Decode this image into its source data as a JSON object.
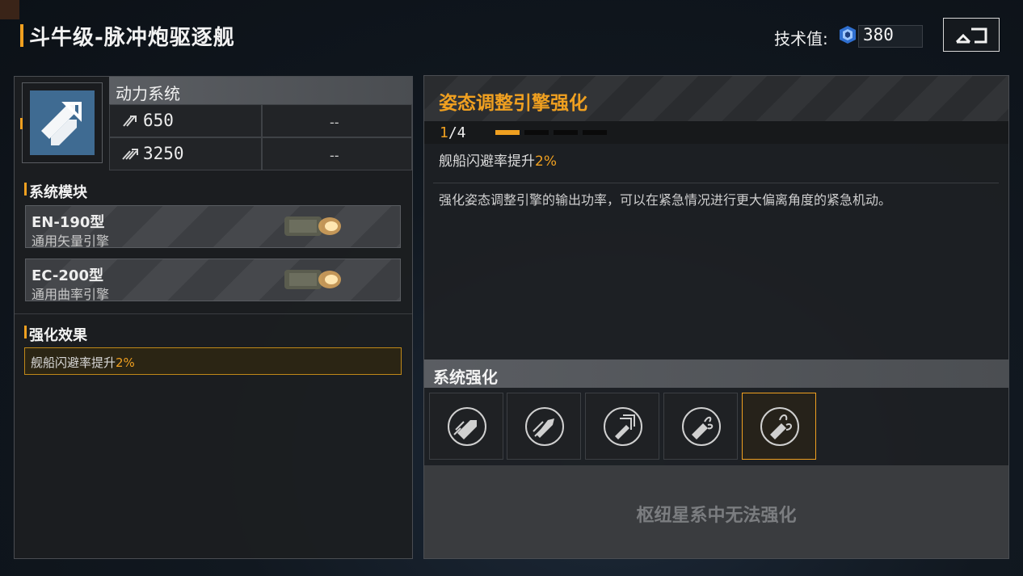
{
  "header": {
    "title": "斗牛级-脉冲炮驱逐舰",
    "tech_label": "技术值:",
    "tech_value": "380",
    "back_icon": "return-icon"
  },
  "system": {
    "icon": "engine-system-icon",
    "name": "动力系统",
    "stats": [
      {
        "icon": "speed-icon",
        "value": "650",
        "extra": "--"
      },
      {
        "icon": "boost-speed-icon",
        "value": "3250",
        "extra": "--"
      }
    ]
  },
  "modules": {
    "title": "系统模块",
    "items": [
      {
        "name": "EN-190型",
        "sub": "通用矢量引擎"
      },
      {
        "name": "EC-200型",
        "sub": "通用曲率引擎"
      }
    ]
  },
  "effects": {
    "title": "强化效果",
    "text_prefix": "舰船闪避率提升",
    "text_value": "2%"
  },
  "upgrade": {
    "title": "姿态调整引擎强化",
    "level_current": "1",
    "level_total": "/4",
    "level_progress": 0.25,
    "effect_prefix": "舰船闪避率提升",
    "effect_value": "2%",
    "description": "强化姿态调整引擎的输出功率，可以在紧急情况进行更大偏离角度的紧急机动。"
  },
  "enhance": {
    "title": "系统强化",
    "slots": [
      {
        "icon": "engine-speed-icon",
        "selected": false
      },
      {
        "icon": "engine-speed-alt-icon",
        "selected": false
      },
      {
        "icon": "engine-boost-icon",
        "selected": false
      },
      {
        "icon": "evasion-icon",
        "selected": false
      },
      {
        "icon": "evasion-alt-icon",
        "selected": true
      }
    ],
    "locked_message": "枢纽星系中无法强化"
  },
  "colors": {
    "accent": "#f0a020",
    "icon_blue": "#3f6b92"
  }
}
